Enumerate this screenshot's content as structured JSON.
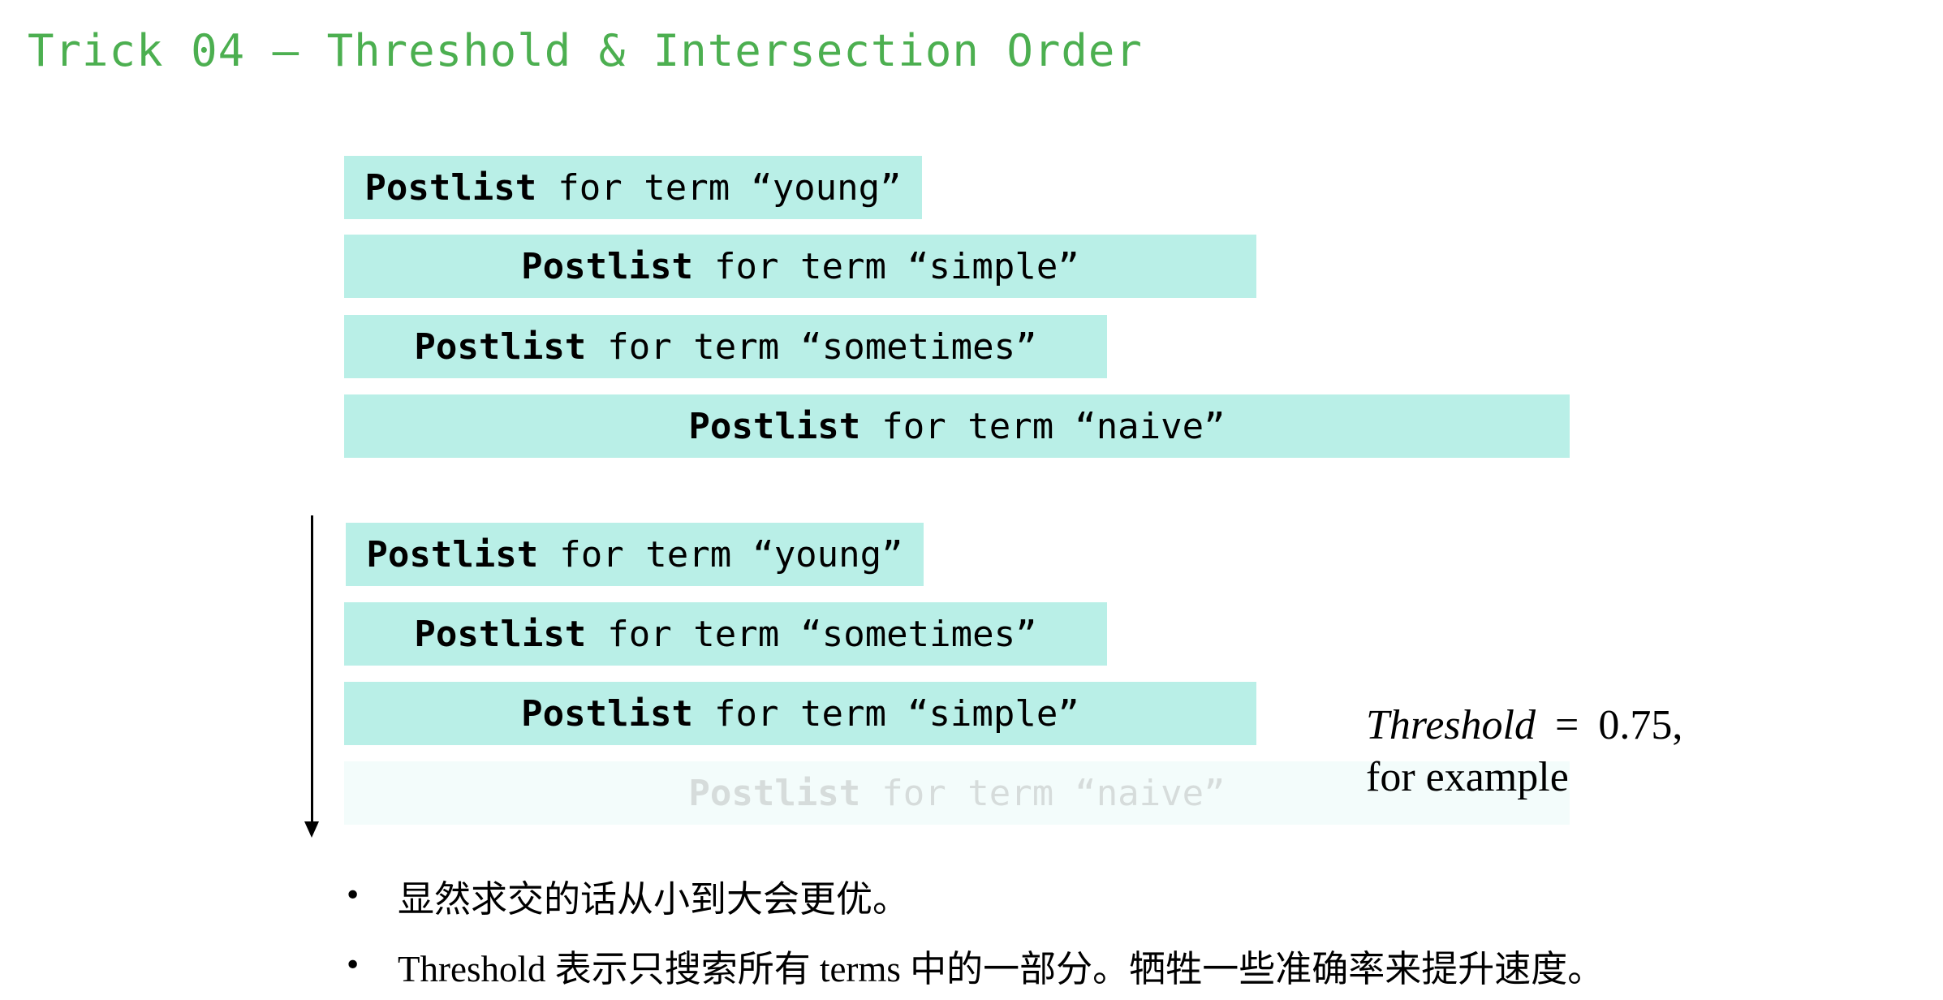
{
  "title": "Trick 04 — Threshold & Intersection Order",
  "term_prefix": "Postlist",
  "term_middle": "for term",
  "original_order": [
    {
      "term": "“young”"
    },
    {
      "term": "“simple”"
    },
    {
      "term": "“sometimes”"
    },
    {
      "term": "“naive”"
    }
  ],
  "sorted_order": [
    {
      "term": "“young”"
    },
    {
      "term": "“sometimes”"
    },
    {
      "term": "“simple”"
    },
    {
      "term": "“naive”",
      "faded": true
    }
  ],
  "threshold": {
    "var": "Threshold",
    "eq": "=",
    "value": "0.75,",
    "note": "for example"
  },
  "bullets": [
    "显然求交的话从小到大会更优。",
    "Threshold 表示只搜索所有 terms 中的一部分。牺牲一些准确率来提升速度。"
  ],
  "colors": {
    "title": "#4caf50",
    "bar": "#b9efe7",
    "bar_faded": "#f3fcfb"
  }
}
